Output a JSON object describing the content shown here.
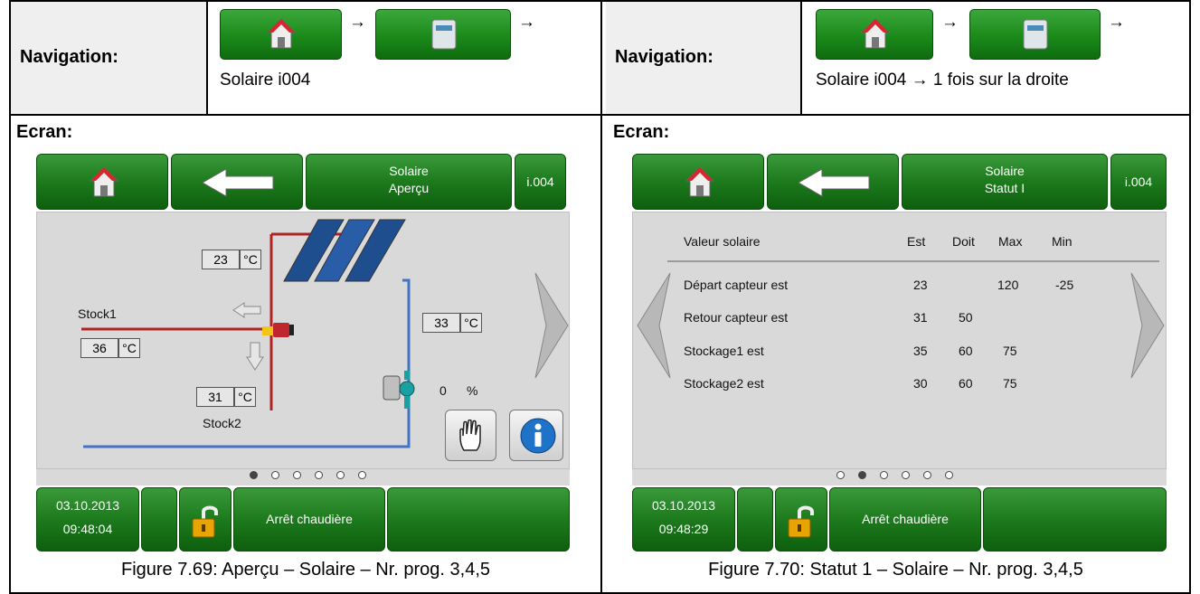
{
  "left": {
    "nav": {
      "title": "Navigation:",
      "path": "Solaire i004",
      "arrow1": "→",
      "arrow2": "→"
    },
    "section": "Ecran:",
    "header": {
      "title_line1": "Solaire",
      "title_line2": "Aperçu",
      "code": "i.004"
    },
    "diagram": {
      "collector_temp": "23",
      "unit": "°C",
      "stock1_label": "Stock1",
      "stock1_temp": "36",
      "stock2_label": "Stock2",
      "stock2_temp": "31",
      "return_temp": "33",
      "pump_value": "0",
      "pump_unit": "%"
    },
    "pages": {
      "count": 6,
      "active": 0
    },
    "footer": {
      "date": "03.10.2013",
      "time": "09:48:04",
      "status": "Arrêt chaudière"
    },
    "caption": "Figure 7.69: Aperçu – Solaire – Nr. prog. 3,4,5"
  },
  "right": {
    "nav": {
      "title": "Navigation:",
      "path": "Solaire i004 → 1 fois sur la droite",
      "arrow1": "→",
      "arrow2": "→"
    },
    "section": "Ecran:",
    "header": {
      "title_line1": "Solaire",
      "title_line2": "Statut I",
      "code": "i.004"
    },
    "table": {
      "headers": [
        "Valeur solaire",
        "Est",
        "Doit",
        "Max",
        "Min"
      ],
      "rows": [
        [
          "Départ capteur est",
          "23",
          "",
          "120",
          "-25"
        ],
        [
          "Retour capteur est",
          "31",
          "50",
          "",
          ""
        ],
        [
          "Stockage1  est",
          "35",
          "60",
          "75",
          ""
        ],
        [
          "Stockage2 est",
          "30",
          "60",
          "75",
          ""
        ]
      ]
    },
    "pages": {
      "count": 6,
      "active": 1
    },
    "footer": {
      "date": "03.10.2013",
      "time": "09:48:29",
      "status": "Arrêt chaudière"
    },
    "caption": "Figure 7.70: Statut 1 – Solaire – Nr. prog. 3,4,5"
  },
  "colors": {
    "button_green": "#1d7a1d",
    "panel_gray": "#d9d9d9",
    "pipe_red": "#b22222",
    "pipe_blue": "#4472c4"
  }
}
